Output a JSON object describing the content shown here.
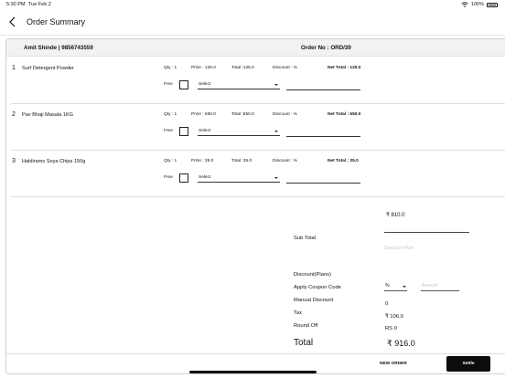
{
  "status_bar": {
    "time": "5:30 PM",
    "date": "Tue Feb 2",
    "battery": "100%"
  },
  "nav": {
    "title": "Order Summary"
  },
  "order": {
    "customer": "Amit Shinde | 9856743559",
    "order_no": "Order No : ORD/39"
  },
  "items": [
    {
      "num": "1",
      "name": "Surf Detergent Powder",
      "qty": "Qty : 1",
      "prize": "Prize : 125.0",
      "total": "Total :125.0",
      "discount": "Discount : %",
      "net_total": "Net Total : 125.0",
      "free_label": "Free",
      "select": "Select"
    },
    {
      "num": "2",
      "name": "Pav Bhaji Masala 1KG",
      "qty": "Qty : 1",
      "prize": "Prize : 650.0",
      "total": "Total :650.0",
      "discount": "Discount : %",
      "net_total": "Net Total : 650.0",
      "free_label": "Free",
      "select": "Select"
    },
    {
      "num": "3",
      "name": "Haldirams Soya Chips 150g",
      "qty": "Qty : 1",
      "prize": "Prize : 35.0",
      "total": "Total :35.0",
      "discount": "Discount : %",
      "net_total": "Net Total : 35.0",
      "free_label": "Free",
      "select": "Select"
    }
  ],
  "summary": {
    "sub_total_value": "₹ 810.0",
    "sub_total_label": "Sub Total",
    "discount_plan_placeholder": "Discount Plan",
    "discount_plans_label": "Discount(Plans)",
    "coupon_label": "Apply Coupon Code",
    "coupon_type": "%",
    "amount_placeholder": "Amount",
    "manual_discount_label": "Manual  Discount",
    "manual_discount_value": "0",
    "tax_label": "Tax",
    "tax_value": "₹ 106.0",
    "round_off_label": "Round Off",
    "round_off_value": "RS 0",
    "total_label": "Total",
    "total_value": "₹ 916.0"
  },
  "footer": {
    "new_order": "NEW ORDER",
    "settle": "Settle"
  },
  "icons": {
    "back": "chevron-left-icon",
    "wifi": "wifi-icon",
    "battery": "battery-icon",
    "dropdown": "caret-down-icon"
  }
}
